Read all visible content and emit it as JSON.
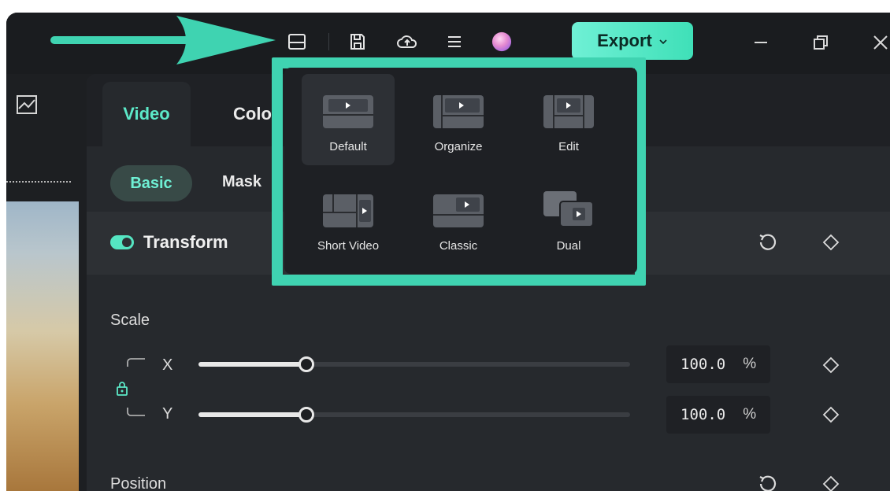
{
  "title_bar": {
    "icons": [
      "layout-icon",
      "save-icon",
      "cloud-upload-icon",
      "menu-icon",
      "avatar"
    ],
    "export_label": "Export",
    "window_controls": [
      "minimize-icon",
      "restore-icon",
      "close-icon"
    ]
  },
  "layout_menu": {
    "items": [
      {
        "label": "Default",
        "icon": "default-layout-icon",
        "selected": true
      },
      {
        "label": "Organize",
        "icon": "organize-layout-icon"
      },
      {
        "label": "Edit",
        "icon": "edit-layout-icon"
      },
      {
        "label": "Short Video",
        "icon": "short-video-layout-icon"
      },
      {
        "label": "Classic",
        "icon": "classic-layout-icon"
      },
      {
        "label": "Dual",
        "icon": "dual-layout-icon"
      }
    ]
  },
  "panel": {
    "tabs": [
      "Video",
      "Colo"
    ],
    "subtabs": [
      "Basic",
      "Mask"
    ],
    "section": {
      "title": "Transform",
      "enabled": true
    },
    "scale": {
      "label": "Scale",
      "x": {
        "axis": "X",
        "value": "100.0",
        "unit": "%",
        "slider_fraction": 0.25
      },
      "y": {
        "axis": "Y",
        "value": "100.0",
        "unit": "%",
        "slider_fraction": 0.25
      }
    },
    "position": {
      "label": "Position"
    }
  },
  "colors": {
    "accent": "#5ce9c8",
    "highlight": "#3fd3b1",
    "panel_bg": "#26292d"
  }
}
